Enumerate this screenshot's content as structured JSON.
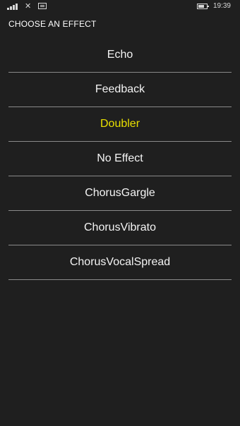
{
  "status_bar": {
    "time": "19:39",
    "icons": [
      "signal-icon",
      "wifi-disconnected-icon",
      "message-icon",
      "battery-icon"
    ]
  },
  "page": {
    "title": "CHOOSE AN EFFECT"
  },
  "effects": [
    {
      "label": "Echo",
      "selected": false
    },
    {
      "label": "Feedback",
      "selected": false
    },
    {
      "label": "Doubler",
      "selected": true
    },
    {
      "label": "No Effect",
      "selected": false
    },
    {
      "label": "ChorusGargle",
      "selected": false
    },
    {
      "label": "ChorusVibrato",
      "selected": false
    },
    {
      "label": "ChorusVocalSpread",
      "selected": false
    }
  ],
  "colors": {
    "background": "#1f1f1f",
    "text": "#f4f4f4",
    "accent": "#e9e000",
    "divider": "#8a8a8a"
  }
}
